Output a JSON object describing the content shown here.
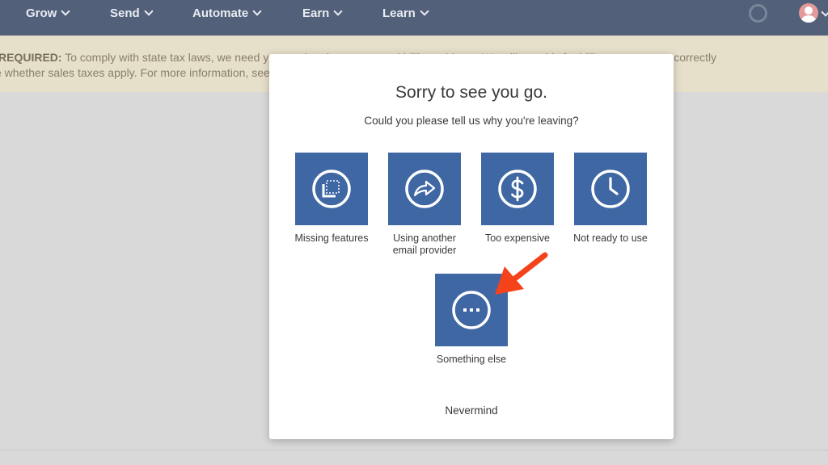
{
  "nav": {
    "items": [
      {
        "label": "Grow"
      },
      {
        "label": "Send"
      },
      {
        "label": "Automate"
      },
      {
        "label": "Earn"
      },
      {
        "label": "Learn"
      }
    ]
  },
  "banner": {
    "bold": "REQUIRED:",
    "line1": "To comply with state tax laws, we need your updated company and billing address. We will use this for billing purposes to correctly",
    "line2": "e whether sales taxes apply. For more information, see our help article."
  },
  "modal": {
    "title": "Sorry to see you go.",
    "subtitle": "Could you please tell us why you're leaving?",
    "options": [
      {
        "label": "Missing features",
        "icon": "missing-features-icon"
      },
      {
        "label_line1": "Using another",
        "label_line2": "email provider",
        "icon": "share-arrow-icon"
      },
      {
        "label": "Too expensive",
        "icon": "dollar-icon"
      },
      {
        "label": "Not ready to use",
        "icon": "clock-icon"
      },
      {
        "label": "Something else",
        "icon": "ellipsis-icon"
      }
    ],
    "nevermind": "Nevermind"
  },
  "colors": {
    "nav_bg": "#52607a",
    "banner_bg": "#e6dfca",
    "tile_blue": "#3e67a3",
    "annotation_arrow": "#f4431b"
  }
}
